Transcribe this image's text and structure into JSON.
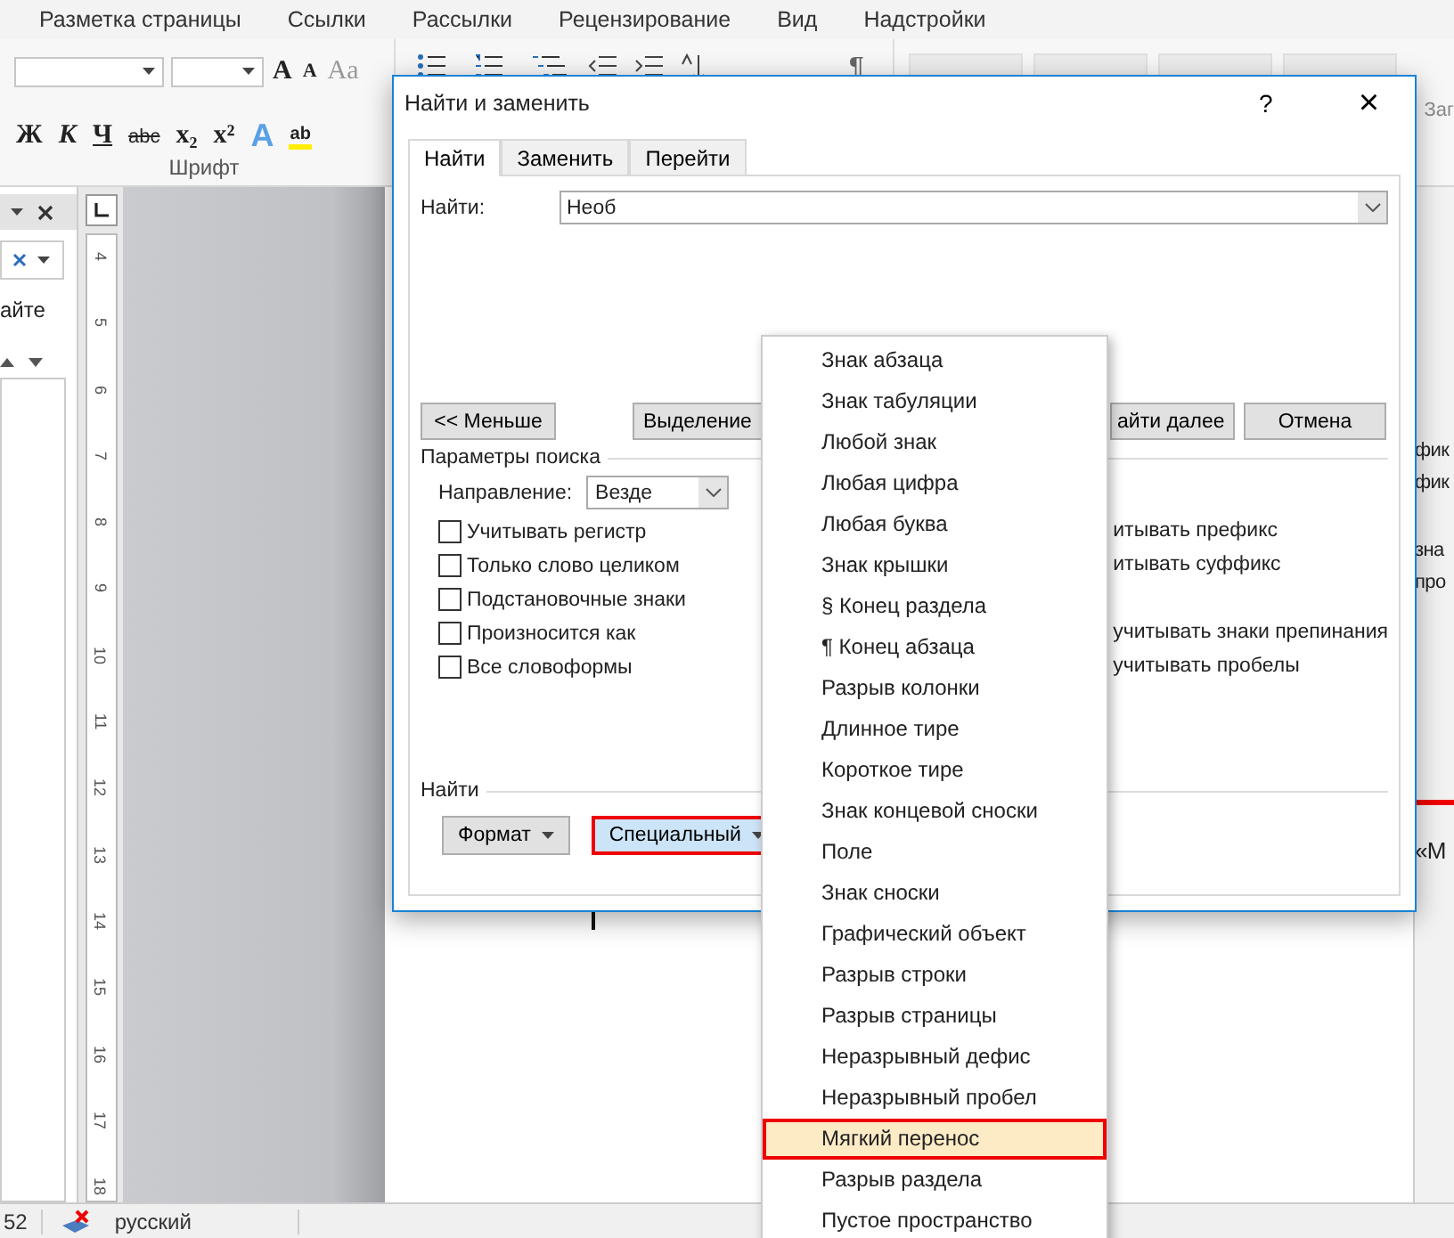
{
  "ribbon_tabs": [
    {
      "label": "Разметка страницы"
    },
    {
      "label": "Ссылки"
    },
    {
      "label": "Рассылки"
    },
    {
      "label": "Рецензирование"
    },
    {
      "label": "Вид"
    },
    {
      "label": "Надстройки"
    }
  ],
  "font_group": {
    "label": "Шрифт",
    "row1": [
      {
        "kind": "grow",
        "label": "A"
      },
      {
        "kind": "shrink",
        "label": "A"
      },
      {
        "kind": "case",
        "label": "Aa"
      }
    ],
    "row2": [
      {
        "kind": "bold",
        "label": "Ж"
      },
      {
        "kind": "italic",
        "label": "К"
      },
      {
        "kind": "underline",
        "label": "Ч"
      },
      {
        "kind": "strike",
        "label": "abc"
      },
      {
        "kind": "sub",
        "label": "x₂"
      },
      {
        "kind": "super",
        "label": "x²"
      },
      {
        "kind": "effects",
        "label": "A"
      },
      {
        "kind": "highlight",
        "label": "ab"
      }
    ]
  },
  "paragraph_group": {
    "pilcrow": "¶"
  },
  "styles_gallery": {
    "partial_label": "Заг"
  },
  "nav_pane": {
    "search_partial": "айте"
  },
  "ruler": {
    "numbers": [
      "4",
      "5",
      "6",
      "7",
      "8",
      "9",
      "10",
      "11",
      "12",
      "13",
      "14",
      "15",
      "16",
      "17",
      "18"
    ]
  },
  "background_fragments": [
    "фик",
    "фик",
    "зна",
    "про"
  ],
  "document_fragment": "«М",
  "dialog": {
    "title": "Найти и заменить",
    "help": "?",
    "close": "×",
    "tabs": [
      {
        "label": "Найти",
        "selected": true
      },
      {
        "label": "Заменить",
        "selected": false
      },
      {
        "label": "Перейти",
        "selected": false
      }
    ],
    "find_label": "Найти:",
    "find_value": "Необ",
    "buttons": [
      {
        "label": "<< Меньше"
      },
      {
        "label": "Выделение"
      },
      {
        "label": "айти далее"
      },
      {
        "label": "Отмена"
      }
    ],
    "options_title": "Параметры поиска",
    "direction_label": "Направление:",
    "direction_value": "Везде",
    "options": [
      {
        "label": "Учитывать регистр",
        "checked": false
      },
      {
        "label": "Только слово целиком",
        "checked": false
      },
      {
        "label": "Подстановочные знаки",
        "checked": false
      },
      {
        "label": "Произносится как",
        "checked": false
      },
      {
        "label": "Все словоформы",
        "checked": false
      }
    ],
    "right_option_groups": [
      {
        "options": [
          "итывать префикс",
          "итывать суффикс"
        ]
      },
      {
        "options": [
          "учитывать знаки препинания",
          "учитывать пробелы"
        ]
      }
    ],
    "find_section": "Найти",
    "bottom_buttons": [
      {
        "label": "Формат",
        "highlighted": false
      },
      {
        "label": "Специальный",
        "highlighted": true
      }
    ]
  },
  "special_menu": [
    {
      "label": "Знак абзаца",
      "selected": false
    },
    {
      "label": "Знак табуляции",
      "selected": false
    },
    {
      "label": "Любой знак",
      "selected": false
    },
    {
      "label": "Любая цифра",
      "selected": false
    },
    {
      "label": "Любая буква",
      "selected": false
    },
    {
      "label": "Знак крышки",
      "selected": false
    },
    {
      "label": "§ Конец раздела",
      "selected": false
    },
    {
      "label": "¶ Конец абзаца",
      "selected": false
    },
    {
      "label": "Разрыв колонки",
      "selected": false
    },
    {
      "label": "Длинное тире",
      "selected": false
    },
    {
      "label": "Короткое тире",
      "selected": false
    },
    {
      "label": "Знак концевой сноски",
      "selected": false
    },
    {
      "label": "Поле",
      "selected": false
    },
    {
      "label": "Знак сноски",
      "selected": false
    },
    {
      "label": "Графический объект",
      "selected": false
    },
    {
      "label": "Разрыв строки",
      "selected": false
    },
    {
      "label": "Разрыв страницы",
      "selected": false
    },
    {
      "label": "Неразрывный дефис",
      "selected": false
    },
    {
      "label": "Неразрывный пробел",
      "selected": false
    },
    {
      "label": "Мягкий перенос",
      "selected": true
    },
    {
      "label": "Разрыв раздела",
      "selected": false
    },
    {
      "label": "Пустое пространство",
      "selected": false
    }
  ],
  "status_bar": {
    "page_count": "52",
    "language": "русский"
  }
}
